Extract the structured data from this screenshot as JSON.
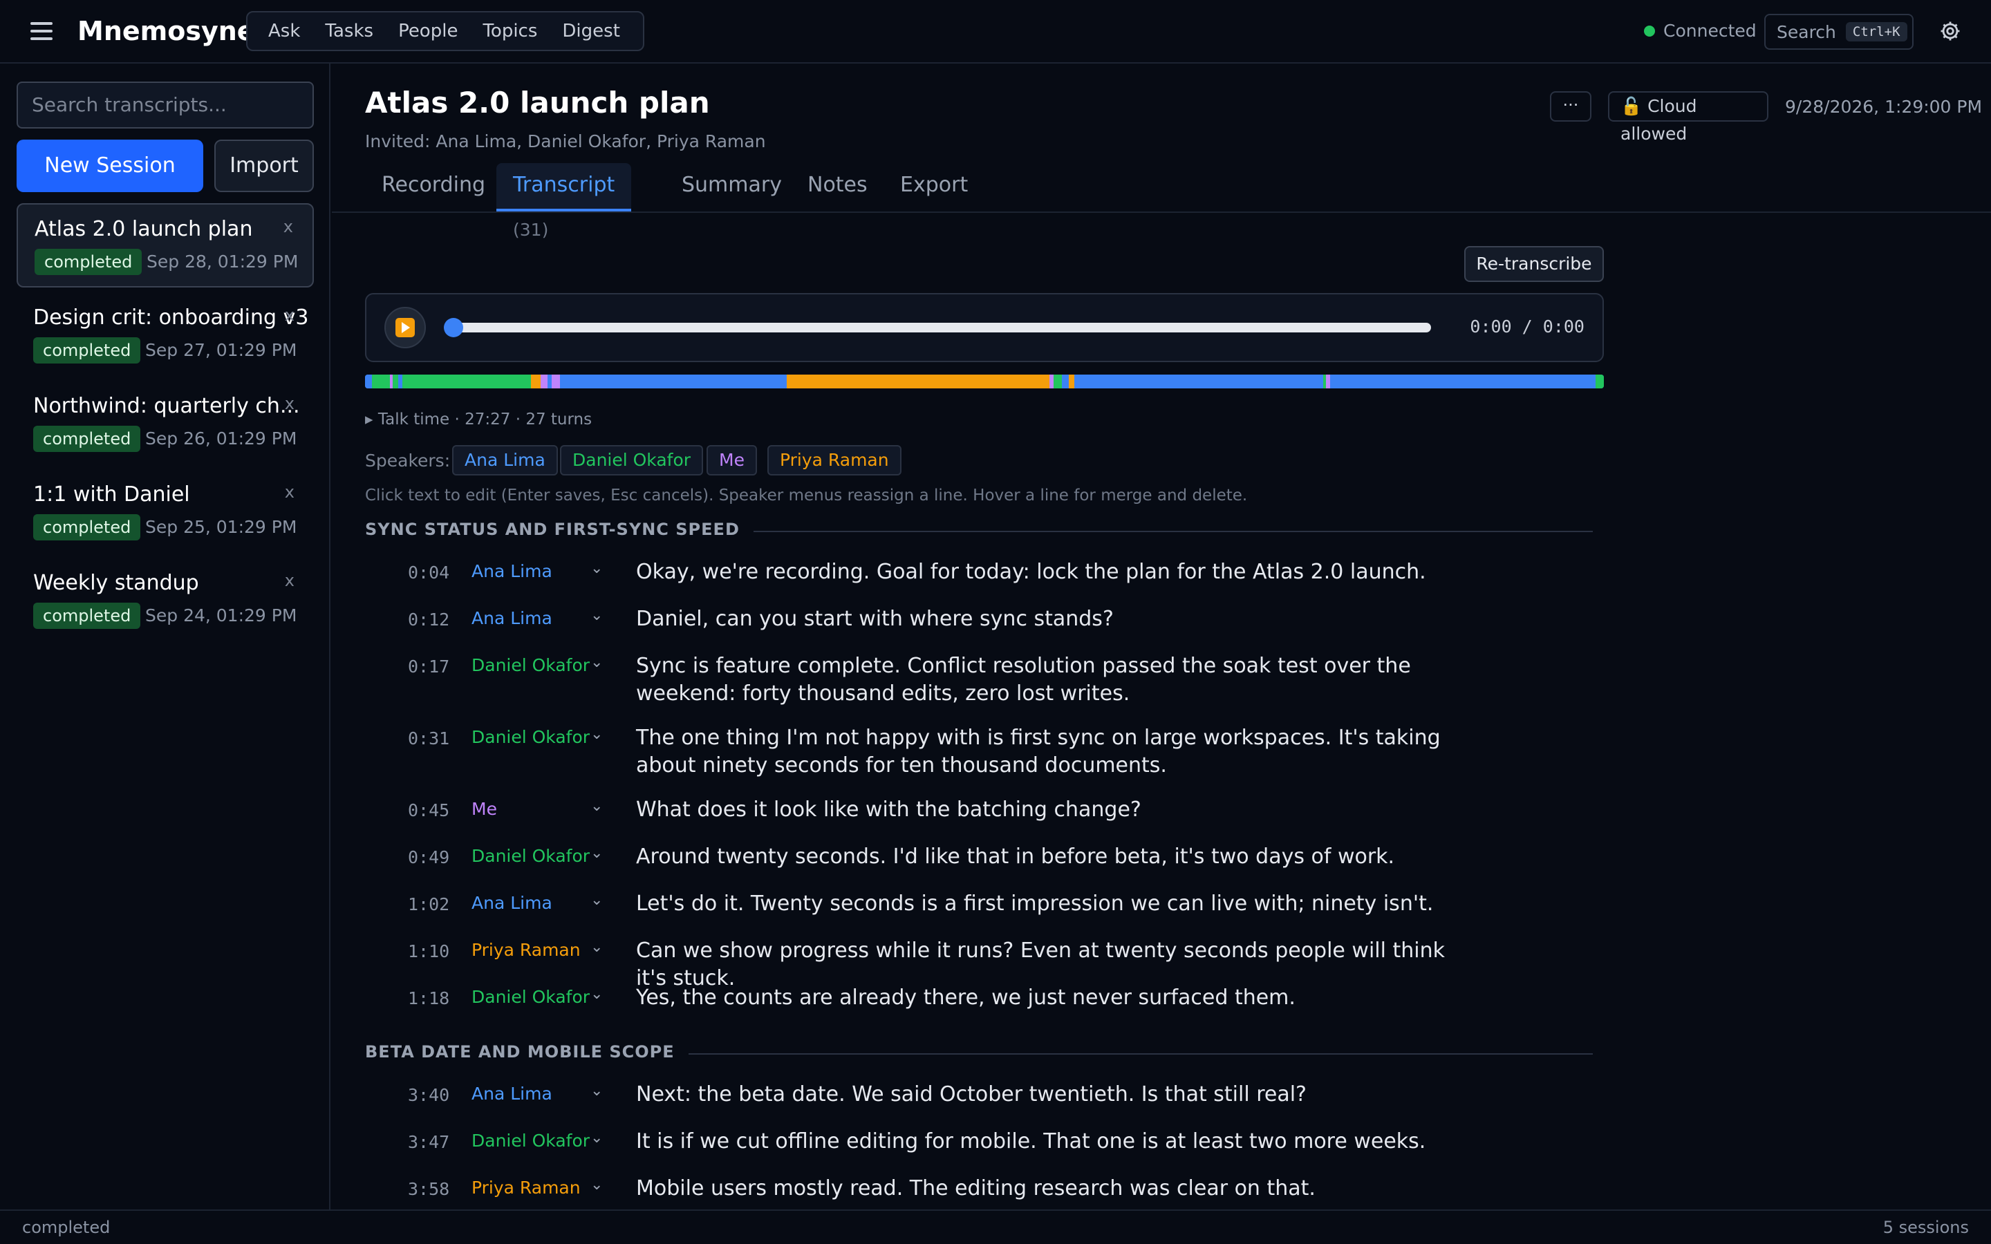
{
  "app": {
    "name": "Mnemosyne"
  },
  "nav": [
    "Ask",
    "Tasks",
    "People",
    "Topics",
    "Digest"
  ],
  "status": {
    "connection": "Connected"
  },
  "search": {
    "label": "Search",
    "shortcut": "Ctrl+K"
  },
  "sidebar": {
    "search_placeholder": "Search transcripts...",
    "new_session": "New Session",
    "import": "Import",
    "close_glyph": "x",
    "sessions": [
      {
        "title": "Atlas 2.0 launch plan",
        "status": "completed",
        "date": "Sep 28, 01:29 PM"
      },
      {
        "title": "Design crit: onboarding v3",
        "status": "completed",
        "date": "Sep 27, 01:29 PM"
      },
      {
        "title": "Northwind: quarterly ch...",
        "status": "completed",
        "date": "Sep 26, 01:29 PM"
      },
      {
        "title": "1:1 with Daniel",
        "status": "completed",
        "date": "Sep 25, 01:29 PM"
      },
      {
        "title": "Weekly standup",
        "status": "completed",
        "date": "Sep 24, 01:29 PM"
      }
    ]
  },
  "session": {
    "title": "Atlas 2.0 launch plan",
    "invited": "Invited: Ana Lima, Daniel Okafor, Priya Raman",
    "more": "···",
    "cloud": "🔓 Cloud allowed",
    "timestamp": "9/28/2026, 1:29:00 PM"
  },
  "tabs": [
    {
      "label": "Recording"
    },
    {
      "label": "Transcript",
      "count": "(31)"
    },
    {
      "label": "Summary"
    },
    {
      "label": "Notes"
    },
    {
      "label": "Export"
    }
  ],
  "transcript": {
    "retranscribe": "Re-transcribe",
    "player": {
      "time": "0:00 / 0:00",
      "progress": 0
    },
    "talktime": "▸ Talk time · 27:27 · 27 turns",
    "speakers_label": "Speakers:",
    "speakers": [
      {
        "name": "Ana Lima",
        "color": "#4e9bff"
      },
      {
        "name": "Daniel Okafor",
        "color": "#22c55e"
      },
      {
        "name": "Me",
        "color": "#c084fc"
      },
      {
        "name": "Priya Raman",
        "color": "#f59e0b"
      }
    ],
    "hint": "Click text to edit (Enter saves, Esc cancels). Speaker menus reassign a line. Hover a line for merge and delete.",
    "sections": [
      {
        "title": "SYNC STATUS AND FIRST-SYNC SPEED",
        "lines": [
          {
            "time": "0:04",
            "speaker": "Ana Lima",
            "text": "Okay, we're recording. Goal for today: lock the plan for the Atlas 2.0 launch."
          },
          {
            "time": "0:12",
            "speaker": "Ana Lima",
            "text": "Daniel, can you start with where sync stands?"
          },
          {
            "time": "0:17",
            "speaker": "Daniel Okafor",
            "text": "Sync is feature complete. Conflict resolution passed the soak test over the weekend: forty thousand edits, zero lost writes."
          },
          {
            "time": "0:31",
            "speaker": "Daniel Okafor",
            "text": "The one thing I'm not happy with is first sync on large workspaces. It's taking about ninety seconds for ten thousand documents."
          },
          {
            "time": "0:45",
            "speaker": "Me",
            "text": "What does it look like with the batching change?"
          },
          {
            "time": "0:49",
            "speaker": "Daniel Okafor",
            "text": "Around twenty seconds. I'd like that in before beta, it's two days of work."
          },
          {
            "time": "1:02",
            "speaker": "Ana Lima",
            "text": "Let's do it. Twenty seconds is a first impression we can live with; ninety isn't."
          },
          {
            "time": "1:10",
            "speaker": "Priya Raman",
            "text": "Can we show progress while it runs? Even at twenty seconds people will think it's stuck."
          },
          {
            "time": "1:18",
            "speaker": "Daniel Okafor",
            "text": "Yes, the counts are already there, we just never surfaced them."
          }
        ]
      },
      {
        "title": "BETA DATE AND MOBILE SCOPE",
        "lines": [
          {
            "time": "3:40",
            "speaker": "Ana Lima",
            "text": "Next: the beta date. We said October twentieth. Is that still real?"
          },
          {
            "time": "3:47",
            "speaker": "Daniel Okafor",
            "text": "It is if we cut offline editing for mobile. That one is at least two more weeks."
          },
          {
            "time": "3:58",
            "speaker": "Priya Raman",
            "text": "Mobile users mostly read. The editing research was clear on that."
          }
        ]
      }
    ]
  },
  "statusbar": {
    "left": "completed",
    "right": "5 sessions"
  }
}
